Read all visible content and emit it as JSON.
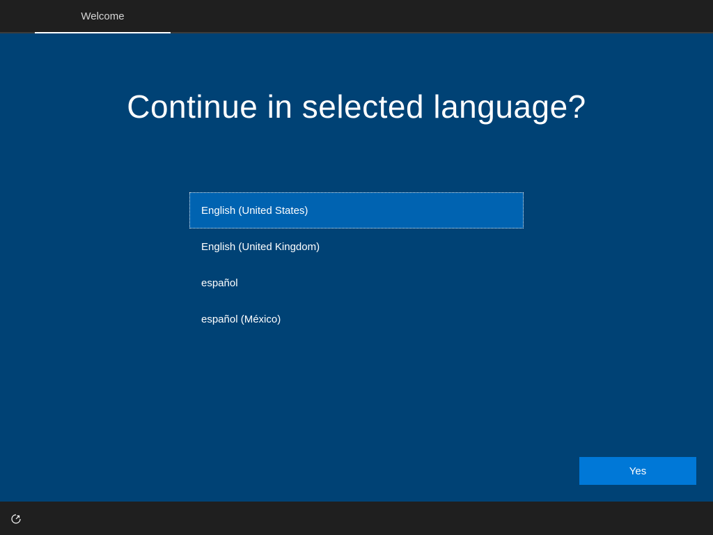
{
  "header": {
    "tab_label": "Welcome"
  },
  "main": {
    "title": "Continue in selected language?",
    "languages": [
      {
        "label": "English (United States)",
        "selected": true
      },
      {
        "label": "English (United Kingdom)",
        "selected": false
      },
      {
        "label": "español",
        "selected": false
      },
      {
        "label": "español (México)",
        "selected": false
      }
    ],
    "yes_label": "Yes"
  },
  "footer": {
    "accessibility_icon": "ease-of-access-icon"
  },
  "colors": {
    "background": "#004275",
    "bars": "#1f1f1f",
    "selected_item": "#0063b1",
    "accent_button": "#0078d7",
    "text": "#ffffff"
  }
}
